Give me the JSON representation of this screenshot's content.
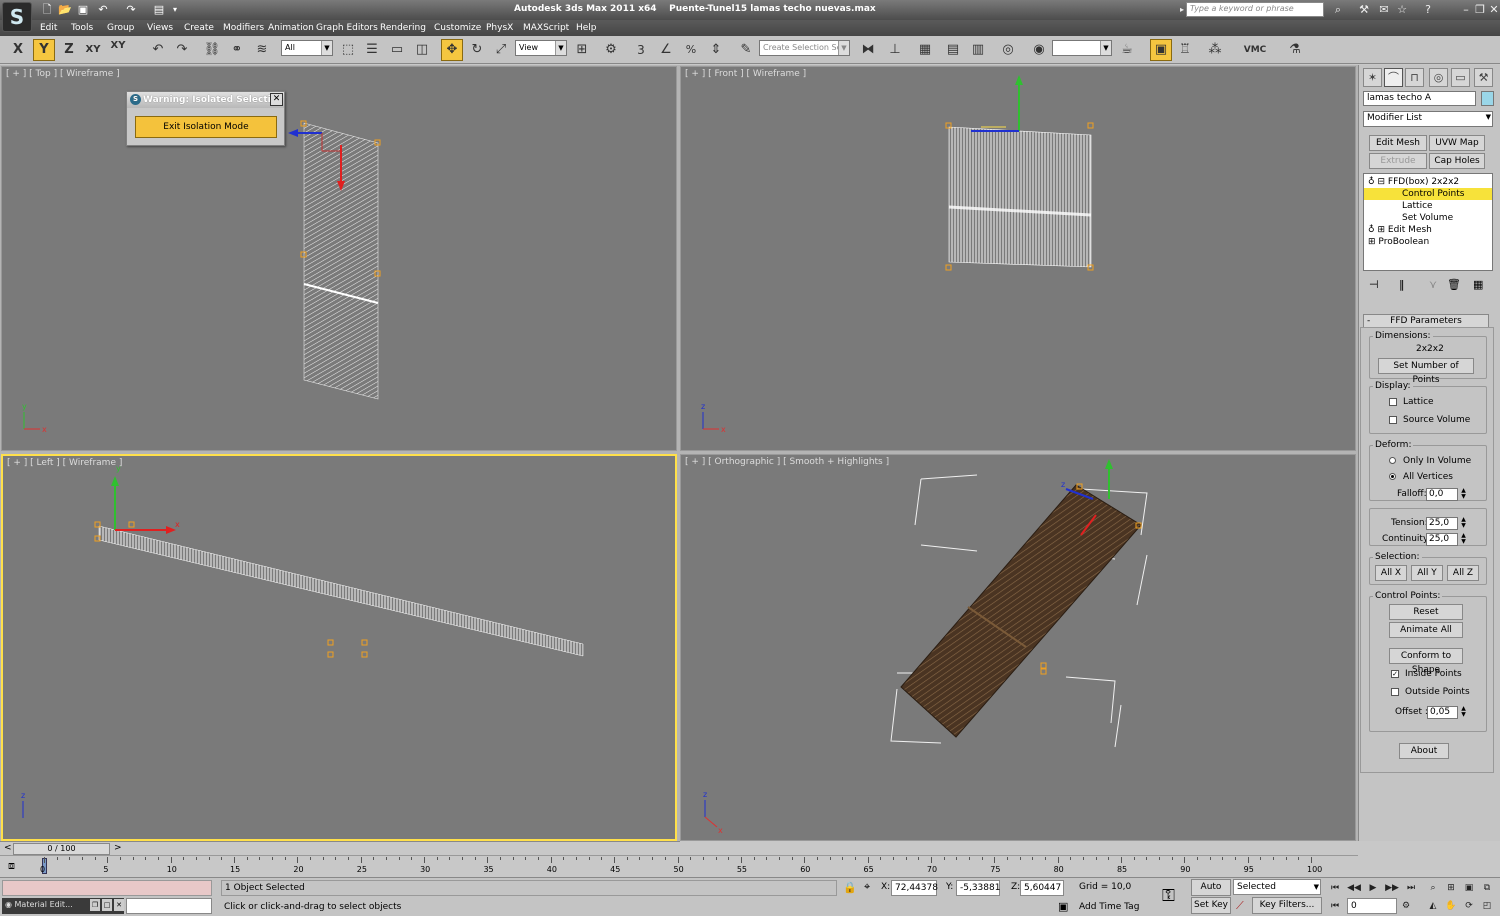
{
  "title": {
    "app": "Autodesk 3ds Max  2011 x64",
    "file": "Puente-Tunel15 lamas techo nuevas.max"
  },
  "search": {
    "placeholder": "Type a keyword or phrase"
  },
  "menu": [
    "Edit",
    "Tools",
    "Group",
    "Views",
    "Create",
    "Modifiers",
    "Animation",
    "Graph Editors",
    "Rendering",
    "Customize",
    "PhysX",
    "MAXScript",
    "Help"
  ],
  "toolbar": {
    "axis_x": "X",
    "axis_y": "Y",
    "axis_z": "Z",
    "axis_xy": "XY",
    "axis_xy2": "XY",
    "selection_filter": "All",
    "ref_coord": "View",
    "selection_set_placeholder": "Create Selection Set",
    "snap_3": "3",
    "vmc_label": "VMC"
  },
  "viewports": {
    "top": {
      "label": "[ + ] [ Top ] [ Wireframe ]"
    },
    "front": {
      "label": "[ + ] [ Front ] [ Wireframe ]"
    },
    "left": {
      "label": "[ + ] [ Left ] [ Wireframe ]"
    },
    "persp": {
      "label": "[ + ] [ Orthographic ] [ Smooth + Highlights ]"
    }
  },
  "axis_labels": {
    "x": "x",
    "y": "y",
    "z": "z"
  },
  "isolate_dialog": {
    "title": "Warning: Isolated Selection",
    "button": "Exit Isolation Mode"
  },
  "command_panel": {
    "object_name": "lamas techo A",
    "object_color": "#9ad6e8",
    "modifier_list": "Modifier List",
    "buttons": {
      "edit_mesh": "Edit Mesh",
      "uvw_map": "UVW Map",
      "extrude": "Extrude",
      "cap_holes": "Cap Holes"
    },
    "stack": {
      "ffd": "FFD(box) 2x2x2",
      "control_points": "Control Points",
      "lattice": "Lattice",
      "set_volume": "Set Volume",
      "edit_mesh": "Edit Mesh",
      "proboolean": "ProBoolean"
    },
    "rollout_title": "FFD Parameters",
    "dimensions": {
      "label": "Dimensions:",
      "value": "2x2x2",
      "button": "Set Number of Points"
    },
    "display": {
      "label": "Display:",
      "lattice": "Lattice",
      "source_volume": "Source Volume"
    },
    "deform": {
      "label": "Deform:",
      "only_in_volume": "Only In Volume",
      "all_vertices": "All Vertices",
      "falloff_label": "Falloff:",
      "falloff_value": "0,0"
    },
    "tension": {
      "label": "Tension:",
      "value": "25,0"
    },
    "continuity": {
      "label": "Continuity:",
      "value": "25,0"
    },
    "selection": {
      "label": "Selection:",
      "all_x": "All X",
      "all_y": "All Y",
      "all_z": "All Z"
    },
    "control_points": {
      "label": "Control Points:",
      "reset": "Reset",
      "animate_all": "Animate All",
      "conform": "Conform to Shape",
      "inside_points": "Inside Points",
      "outside_points": "Outside Points",
      "offset_label": "Offset :",
      "offset_value": "0,05"
    },
    "about": "About"
  },
  "timeline": {
    "frame": "0 / 100",
    "prev": "<",
    "next": ">",
    "ticks": [
      "0",
      "5",
      "10",
      "15",
      "20",
      "25",
      "30",
      "35",
      "40",
      "45",
      "50",
      "55",
      "60",
      "65",
      "70",
      "75",
      "80",
      "85",
      "90",
      "95",
      "100"
    ]
  },
  "status": {
    "material_editor": "Material Edit...",
    "objects_selected": "1 Object Selected",
    "prompt": "Click or click-and-drag to select objects",
    "x_label": "X:",
    "x_value": "72,44378",
    "y_label": "Y:",
    "y_value": "-5,33881",
    "z_label": "Z:",
    "z_value": "5,60447",
    "grid": "Grid = 10,0",
    "add_time_tag": "Add Time Tag",
    "auto_key": "Auto Key",
    "set_key": "Set Key",
    "key_mode": "Selected",
    "key_filters": "Key Filters...",
    "current_frame": "0"
  }
}
